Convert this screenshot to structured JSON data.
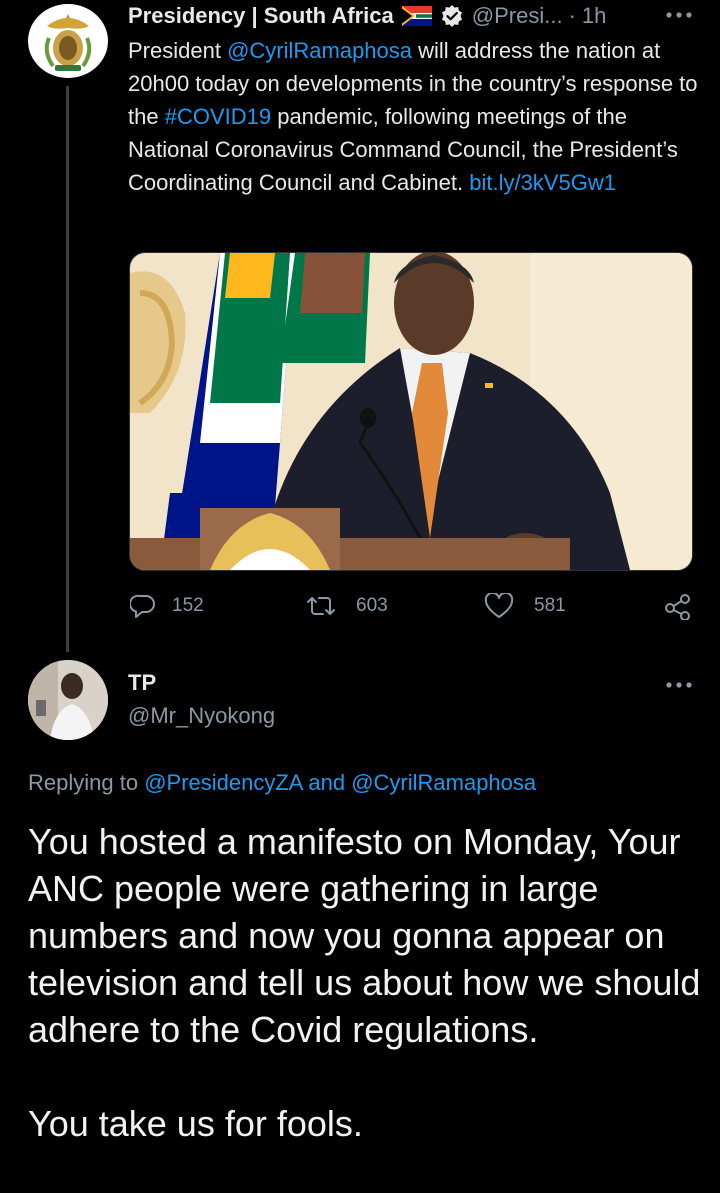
{
  "tweet": {
    "author": {
      "name": "Presidency | South Africa",
      "handle": "@Presi...",
      "time": "1h",
      "verified": true,
      "flag": "south-africa-flag-icon"
    },
    "text_parts": {
      "p1": "President ",
      "mention": "@CyrilRamaphosa",
      "p2": " will address the nation at 20h00 today on developments in the country’s response to the ",
      "hashtag": "#COVID19",
      "p3": " pandemic, following meetings of the National Coronavirus Command Council, the President’s Coordinating Council and Cabinet. ",
      "link": "bit.ly/3kV5Gw1"
    },
    "stats": {
      "replies": "152",
      "retweets": "603",
      "likes": "581"
    }
  },
  "reply": {
    "author": {
      "name": "TP",
      "handle": "@Mr_Nyokong"
    },
    "replying": {
      "prefix": "Replying to ",
      "mention1": "@PresidencyZA",
      "and": " and ",
      "mention2": "@CyrilRamaphosa"
    },
    "body": {
      "paragraph1": "You hosted a manifesto on Monday, Your ANC people were gathering in large numbers and now you gonna appear on television and tell us about how we should adhere to the Covid regulations.",
      "paragraph2": "You take us for fools."
    }
  },
  "colors": {
    "background": "#000000",
    "link": "#1d9bf0",
    "muted": "#8b98a5",
    "text": "#e7e9ea"
  }
}
